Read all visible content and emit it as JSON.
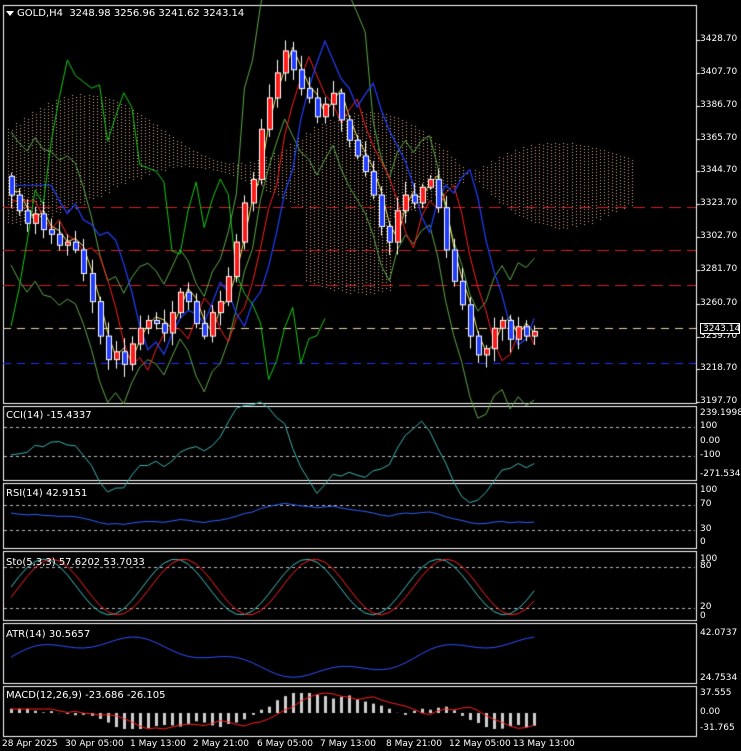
{
  "main": {
    "symbol": "GOLD,H4",
    "ohlc": "3248.98 3256.96 3241.62 3243.14",
    "current_price": "3243.14",
    "price_ticks": [
      "3428.70",
      "3407.70",
      "3386.70",
      "3365.70",
      "3344.70",
      "3323.70",
      "3302.70",
      "3281.70",
      "3260.70",
      "3239.70",
      "3218.70",
      "3197.70"
    ]
  },
  "panels": {
    "cci": {
      "title": "CCI(14) -15.4337",
      "ticks": [
        "239.1998",
        "100",
        "0.00",
        "-100",
        "-271.5346"
      ]
    },
    "rsi": {
      "title": "RSI(14) 42.9151",
      "ticks": [
        "100",
        "70",
        "30",
        "0"
      ]
    },
    "sto": {
      "title": "Sto(5,3,3) 57.6202 53.7033",
      "ticks": [
        "100",
        "80",
        "20",
        "0"
      ]
    },
    "atr": {
      "title": "ATR(14) 30.5657",
      "ticks": [
        "42.0737",
        "24.7534"
      ]
    },
    "macd": {
      "title": "MACD(12,26,9) -23.686 -26.105",
      "ticks": [
        "37.555",
        "0.00",
        "-31.765"
      ]
    }
  },
  "time_axis": [
    "28 Apr 2025",
    "30 Apr 05:00",
    "1 May 13:00",
    "2 May 21:00",
    "6 May 05:00",
    "7 May 13:00",
    "8 May 21:00",
    "12 May 05:00",
    "13 May 13:00"
  ],
  "colors": {
    "bull": "#ff0000",
    "bear": "#1e3cff",
    "grid": "#ffffff",
    "ichimoku": "#ffa07a",
    "lagging": "#00c800",
    "bollinger": "#7cc35a"
  }
}
